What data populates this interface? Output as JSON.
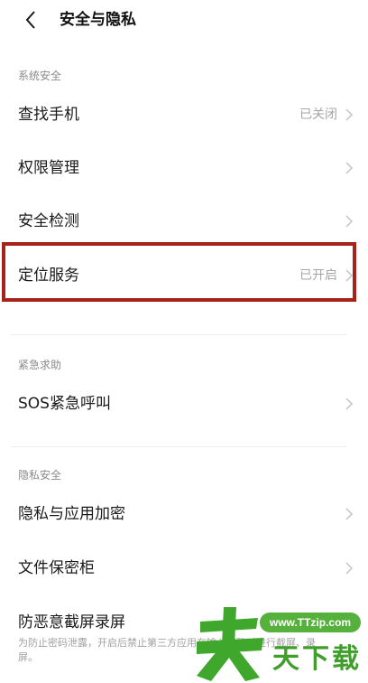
{
  "header": {
    "title": "安全与隐私"
  },
  "sections": [
    {
      "title": "系统安全",
      "items": [
        {
          "label": "查找手机",
          "value": "已关闭"
        },
        {
          "label": "权限管理",
          "value": ""
        },
        {
          "label": "安全检测",
          "value": ""
        },
        {
          "label": "定位服务",
          "value": "已开启"
        }
      ]
    },
    {
      "title": "紧急求助",
      "items": [
        {
          "label": "SOS紧急呼叫",
          "value": ""
        }
      ]
    },
    {
      "title": "隐私安全",
      "items": [
        {
          "label": "隐私与应用加密",
          "value": ""
        },
        {
          "label": "文件保密柜",
          "value": ""
        },
        {
          "label": "防恶意截屏录屏",
          "subtitle": "为防止密码泄露，开启后禁止第三方应用在输入密码时进行截屏、录屏。"
        }
      ]
    }
  ],
  "watermark": {
    "url": "www.TTzip.com",
    "text": "天下载"
  },
  "colors": {
    "highlight": "#a8221c",
    "watermark": "#56b13c"
  }
}
